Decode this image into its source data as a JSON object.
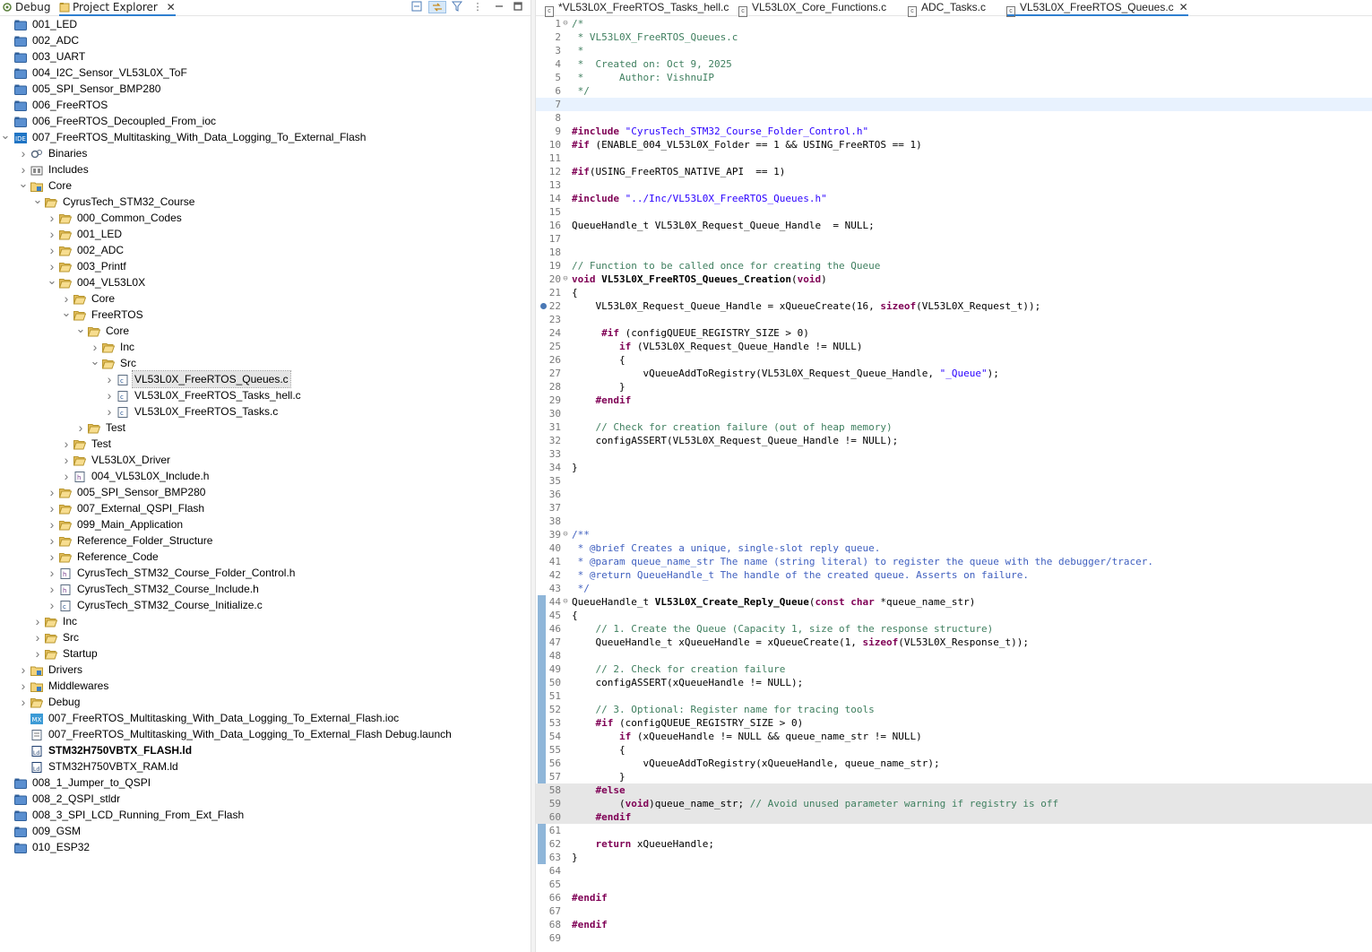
{
  "left_tabs": [
    {
      "label": "Debug"
    },
    {
      "label": "Project Explorer"
    }
  ],
  "tree": [
    {
      "depth": 0,
      "icon": "folder",
      "label": "001_LED",
      "exp": "none"
    },
    {
      "depth": 0,
      "icon": "folder",
      "label": "002_ADC",
      "exp": "none"
    },
    {
      "depth": 0,
      "icon": "folder",
      "label": "003_UART",
      "exp": "none"
    },
    {
      "depth": 0,
      "icon": "folder",
      "label": "004_I2C_Sensor_VL53L0X_ToF",
      "exp": "none"
    },
    {
      "depth": 0,
      "icon": "folder",
      "label": "005_SPI_Sensor_BMP280",
      "exp": "none"
    },
    {
      "depth": 0,
      "icon": "folder",
      "label": "006_FreeRTOS",
      "exp": "none"
    },
    {
      "depth": 0,
      "icon": "folder",
      "label": "006_FreeRTOS_Decoupled_From_ioc",
      "exp": "none"
    },
    {
      "depth": 0,
      "icon": "ide",
      "label": "007_FreeRTOS_Multitasking_With_Data_Logging_To_External_Flash",
      "exp": "open"
    },
    {
      "depth": 1,
      "icon": "binaries",
      "label": "Binaries",
      "exp": "closed"
    },
    {
      "depth": 1,
      "icon": "includes",
      "label": "Includes",
      "exp": "closed"
    },
    {
      "depth": 1,
      "icon": "srcfolder",
      "label": "Core",
      "exp": "open"
    },
    {
      "depth": 2,
      "icon": "openfolder",
      "label": "CyrusTech_STM32_Course",
      "exp": "open"
    },
    {
      "depth": 3,
      "icon": "openfolder",
      "label": "000_Common_Codes",
      "exp": "closed"
    },
    {
      "depth": 3,
      "icon": "openfolder",
      "label": "001_LED",
      "exp": "closed"
    },
    {
      "depth": 3,
      "icon": "openfolder",
      "label": "002_ADC",
      "exp": "closed"
    },
    {
      "depth": 3,
      "icon": "openfolder",
      "label": "003_Printf",
      "exp": "closed"
    },
    {
      "depth": 3,
      "icon": "openfolder",
      "label": "004_VL53L0X",
      "exp": "open"
    },
    {
      "depth": 4,
      "icon": "openfolder",
      "label": "Core",
      "exp": "closed"
    },
    {
      "depth": 4,
      "icon": "openfolder",
      "label": "FreeRTOS",
      "exp": "open"
    },
    {
      "depth": 5,
      "icon": "openfolder",
      "label": "Core",
      "exp": "open"
    },
    {
      "depth": 6,
      "icon": "openfolder",
      "label": "Inc",
      "exp": "closed"
    },
    {
      "depth": 6,
      "icon": "openfolder",
      "label": "Src",
      "exp": "open"
    },
    {
      "depth": 7,
      "icon": "cfile",
      "label": "VL53L0X_FreeRTOS_Queues.c",
      "exp": "closed",
      "selected": true
    },
    {
      "depth": 7,
      "icon": "cfile",
      "label": "VL53L0X_FreeRTOS_Tasks_hell.c",
      "exp": "closed"
    },
    {
      "depth": 7,
      "icon": "cfile",
      "label": "VL53L0X_FreeRTOS_Tasks.c",
      "exp": "closed"
    },
    {
      "depth": 5,
      "icon": "openfolder",
      "label": "Test",
      "exp": "closed"
    },
    {
      "depth": 4,
      "icon": "openfolder",
      "label": "Test",
      "exp": "closed"
    },
    {
      "depth": 4,
      "icon": "openfolder",
      "label": "VL53L0X_Driver",
      "exp": "closed"
    },
    {
      "depth": 4,
      "icon": "hfile",
      "label": "004_VL53L0X_Include.h",
      "exp": "closed"
    },
    {
      "depth": 3,
      "icon": "openfolder",
      "label": "005_SPI_Sensor_BMP280",
      "exp": "closed"
    },
    {
      "depth": 3,
      "icon": "openfolder",
      "label": "007_External_QSPI_Flash",
      "exp": "closed"
    },
    {
      "depth": 3,
      "icon": "openfolder",
      "label": "099_Main_Application",
      "exp": "closed"
    },
    {
      "depth": 3,
      "icon": "openfolder",
      "label": "Reference_Folder_Structure",
      "exp": "closed"
    },
    {
      "depth": 3,
      "icon": "openfolder",
      "label": "Reference_Code",
      "exp": "closed"
    },
    {
      "depth": 3,
      "icon": "hfile",
      "label": "CyrusTech_STM32_Course_Folder_Control.h",
      "exp": "closed"
    },
    {
      "depth": 3,
      "icon": "hfile",
      "label": "CyrusTech_STM32_Course_Include.h",
      "exp": "closed"
    },
    {
      "depth": 3,
      "icon": "cfile",
      "label": "CyrusTech_STM32_Course_Initialize.c",
      "exp": "closed"
    },
    {
      "depth": 2,
      "icon": "openfolder",
      "label": "Inc",
      "exp": "closed"
    },
    {
      "depth": 2,
      "icon": "openfolder",
      "label": "Src",
      "exp": "closed"
    },
    {
      "depth": 2,
      "icon": "openfolder",
      "label": "Startup",
      "exp": "closed"
    },
    {
      "depth": 1,
      "icon": "srcfolder",
      "label": "Drivers",
      "exp": "closed"
    },
    {
      "depth": 1,
      "icon": "srcfolder",
      "label": "Middlewares",
      "exp": "closed"
    },
    {
      "depth": 1,
      "icon": "openfolder",
      "label": "Debug",
      "exp": "closed"
    },
    {
      "depth": 1,
      "icon": "mx",
      "label": "007_FreeRTOS_Multitasking_With_Data_Logging_To_External_Flash.ioc",
      "exp": "none"
    },
    {
      "depth": 1,
      "icon": "launch",
      "label": "007_FreeRTOS_Multitasking_With_Data_Logging_To_External_Flash Debug.launch",
      "exp": "none"
    },
    {
      "depth": 1,
      "icon": "ld",
      "label": "STM32H750VBTX_FLASH.ld",
      "exp": "none",
      "bold": true
    },
    {
      "depth": 1,
      "icon": "ld",
      "label": "STM32H750VBTX_RAM.ld",
      "exp": "none"
    },
    {
      "depth": 0,
      "icon": "folder",
      "label": "008_1_Jumper_to_QSPI",
      "exp": "none"
    },
    {
      "depth": 0,
      "icon": "folder",
      "label": "008_2_QSPI_stldr",
      "exp": "none"
    },
    {
      "depth": 0,
      "icon": "folder",
      "label": "008_3_SPI_LCD_Running_From_Ext_Flash",
      "exp": "none"
    },
    {
      "depth": 0,
      "icon": "folder",
      "label": "009_GSM",
      "exp": "none"
    },
    {
      "depth": 0,
      "icon": "folder",
      "label": "010_ESP32",
      "exp": "none"
    }
  ],
  "editor_tabs": [
    {
      "label": "*VL53L0X_FreeRTOS_Tasks_hell.c",
      "active": false
    },
    {
      "label": "VL53L0X_Core_Functions.c",
      "active": false
    },
    {
      "label": "ADC_Tasks.c",
      "active": false
    },
    {
      "label": "VL53L0X_FreeRTOS_Queues.c",
      "active": true
    }
  ],
  "code": [
    {
      "n": "1",
      "fold": "⊖",
      "s": [
        [
          "/*",
          "cm"
        ]
      ]
    },
    {
      "n": "2",
      "s": [
        [
          " * VL53L0X_FreeRTOS_Queues.c",
          "cm"
        ]
      ]
    },
    {
      "n": "3",
      "s": [
        [
          " *",
          "cm"
        ]
      ]
    },
    {
      "n": "4",
      "s": [
        [
          " *  Created on: Oct 9, 2025",
          "cm"
        ]
      ]
    },
    {
      "n": "5",
      "s": [
        [
          " *      Author: VishnuIP",
          "cm"
        ]
      ]
    },
    {
      "n": "6",
      "s": [
        [
          " */",
          "cm"
        ]
      ]
    },
    {
      "n": "7",
      "cur": true,
      "s": []
    },
    {
      "n": "8",
      "s": []
    },
    {
      "n": "9",
      "s": [
        [
          "#include",
          "kw"
        ],
        [
          " ",
          ""
        ],
        [
          "\"CyrusTech_STM32_Course_Folder_Control.h\"",
          "st"
        ]
      ]
    },
    {
      "n": "10",
      "s": [
        [
          "#if",
          "kw"
        ],
        [
          " (ENABLE_004_VL53L0X_Folder == 1 && USING_FreeRTOS == 1)",
          ""
        ]
      ]
    },
    {
      "n": "11",
      "s": []
    },
    {
      "n": "12",
      "s": [
        [
          "#if",
          "kw"
        ],
        [
          "(USING_FreeRTOS_NATIVE_API  == 1)",
          ""
        ]
      ]
    },
    {
      "n": "13",
      "s": []
    },
    {
      "n": "14",
      "s": [
        [
          "#include",
          "kw"
        ],
        [
          " ",
          ""
        ],
        [
          "\"../Inc/VL53L0X_FreeRTOS_Queues.h\"",
          "st"
        ]
      ]
    },
    {
      "n": "15",
      "s": []
    },
    {
      "n": "16",
      "s": [
        [
          "QueueHandle_t VL53L0X_Request_Queue_Handle  = NULL;",
          ""
        ]
      ]
    },
    {
      "n": "17",
      "s": []
    },
    {
      "n": "18",
      "s": []
    },
    {
      "n": "19",
      "s": [
        [
          "// Function to be called once for creating the Queue",
          "cm"
        ]
      ]
    },
    {
      "n": "20",
      "fold": "⊖",
      "s": [
        [
          "void",
          "kw"
        ],
        [
          " ",
          ""
        ],
        [
          "VL53L0X_FreeRTOS_Queues_Creation",
          "fn"
        ],
        [
          "(",
          ""
        ],
        [
          "void",
          "kw"
        ],
        [
          ")",
          ""
        ]
      ]
    },
    {
      "n": "21",
      "s": [
        [
          "{",
          ""
        ]
      ]
    },
    {
      "n": "22",
      "marker": true,
      "s": [
        [
          "    VL53L0X_Request_Queue_Handle = xQueueCreate(16, ",
          ""
        ],
        [
          "sizeof",
          "kw"
        ],
        [
          "(VL53L0X_Request_t));",
          ""
        ]
      ]
    },
    {
      "n": "23",
      "s": []
    },
    {
      "n": "24",
      "s": [
        [
          "     ",
          ""
        ],
        [
          "#if",
          "kw"
        ],
        [
          " (configQUEUE_REGISTRY_SIZE > 0)",
          ""
        ]
      ]
    },
    {
      "n": "25",
      "s": [
        [
          "        ",
          ""
        ],
        [
          "if",
          "kw"
        ],
        [
          " (VL53L0X_Request_Queue_Handle != NULL)",
          ""
        ]
      ]
    },
    {
      "n": "26",
      "s": [
        [
          "        {",
          ""
        ]
      ]
    },
    {
      "n": "27",
      "s": [
        [
          "            vQueueAddToRegistry(VL53L0X_Request_Queue_Handle, ",
          ""
        ],
        [
          "\"_Queue\"",
          "st"
        ],
        [
          ");",
          ""
        ]
      ]
    },
    {
      "n": "28",
      "s": [
        [
          "        }",
          ""
        ]
      ]
    },
    {
      "n": "29",
      "s": [
        [
          "    ",
          ""
        ],
        [
          "#endif",
          "kw"
        ]
      ]
    },
    {
      "n": "30",
      "s": []
    },
    {
      "n": "31",
      "s": [
        [
          "    // Check for creation failure (out of heap memory)",
          "cm"
        ]
      ]
    },
    {
      "n": "32",
      "s": [
        [
          "    configASSERT(VL53L0X_Request_Queue_Handle != NULL);",
          ""
        ]
      ]
    },
    {
      "n": "33",
      "s": []
    },
    {
      "n": "34",
      "s": [
        [
          "}",
          ""
        ]
      ]
    },
    {
      "n": "35",
      "s": []
    },
    {
      "n": "36",
      "s": []
    },
    {
      "n": "37",
      "s": []
    },
    {
      "n": "38",
      "s": []
    },
    {
      "n": "39",
      "fold": "⊖",
      "s": [
        [
          "/**",
          "dc"
        ]
      ]
    },
    {
      "n": "40",
      "s": [
        [
          " * @brief Creates a unique, single-slot reply queue.",
          "dc"
        ]
      ]
    },
    {
      "n": "41",
      "s": [
        [
          " * @param queue_name_str The name (string literal) to register the queue with the debugger/tracer.",
          "dc"
        ]
      ]
    },
    {
      "n": "42",
      "s": [
        [
          " * @return QueueHandle_t The handle of the created queue. Asserts on failure.",
          "dc"
        ]
      ]
    },
    {
      "n": "43",
      "s": [
        [
          " */",
          "dc"
        ]
      ]
    },
    {
      "n": "44",
      "fold": "⊖",
      "s": [
        [
          "QueueHandle_t ",
          ""
        ],
        [
          "VL53L0X_Create_Reply_Queue",
          "fn"
        ],
        [
          "(",
          ""
        ],
        [
          "const",
          "kw"
        ],
        [
          " ",
          ""
        ],
        [
          "char",
          "kw"
        ],
        [
          " *queue_name_str)",
          ""
        ]
      ]
    },
    {
      "n": "45",
      "s": [
        [
          "{",
          ""
        ]
      ]
    },
    {
      "n": "46",
      "s": [
        [
          "    // 1. Create the Queue (Capacity 1, size of the response structure)",
          "cm"
        ]
      ]
    },
    {
      "n": "47",
      "s": [
        [
          "    QueueHandle_t xQueueHandle = xQueueCreate(1, ",
          ""
        ],
        [
          "sizeof",
          "kw"
        ],
        [
          "(VL53L0X_Response_t));",
          ""
        ]
      ]
    },
    {
      "n": "48",
      "s": []
    },
    {
      "n": "49",
      "s": [
        [
          "    // 2. Check for creation failure",
          "cm"
        ]
      ]
    },
    {
      "n": "50",
      "s": [
        [
          "    configASSERT(xQueueHandle != NULL);",
          ""
        ]
      ]
    },
    {
      "n": "51",
      "s": []
    },
    {
      "n": "52",
      "s": [
        [
          "    // 3. Optional: Register name for tracing tools",
          "cm"
        ]
      ]
    },
    {
      "n": "53",
      "s": [
        [
          "    ",
          ""
        ],
        [
          "#if",
          "kw"
        ],
        [
          " (configQUEUE_REGISTRY_SIZE > 0)",
          ""
        ]
      ]
    },
    {
      "n": "54",
      "s": [
        [
          "        ",
          ""
        ],
        [
          "if",
          "kw"
        ],
        [
          " (xQueueHandle != NULL && queue_name_str != NULL)",
          ""
        ]
      ]
    },
    {
      "n": "55",
      "s": [
        [
          "        {",
          ""
        ]
      ]
    },
    {
      "n": "56",
      "s": [
        [
          "            vQueueAddToRegistry(xQueueHandle, queue_name_str);",
          ""
        ]
      ]
    },
    {
      "n": "57",
      "s": [
        [
          "        }",
          ""
        ]
      ]
    },
    {
      "n": "58",
      "grey": true,
      "s": [
        [
          "    ",
          ""
        ],
        [
          "#else",
          "kw"
        ]
      ]
    },
    {
      "n": "59",
      "grey": true,
      "s": [
        [
          "        (",
          ""
        ],
        [
          "void",
          "kw"
        ],
        [
          ")queue_name_str; ",
          ""
        ],
        [
          "// Avoid unused parameter warning if registry is off",
          "cm"
        ]
      ]
    },
    {
      "n": "60",
      "grey": true,
      "s": [
        [
          "    ",
          ""
        ],
        [
          "#endif",
          "kw"
        ]
      ]
    },
    {
      "n": "61",
      "s": []
    },
    {
      "n": "62",
      "s": [
        [
          "    ",
          ""
        ],
        [
          "return",
          "kw"
        ],
        [
          " xQueueHandle;",
          ""
        ]
      ]
    },
    {
      "n": "63",
      "s": [
        [
          "}",
          ""
        ]
      ]
    },
    {
      "n": "64",
      "s": []
    },
    {
      "n": "65",
      "s": []
    },
    {
      "n": "66",
      "s": [
        [
          "#endif",
          "kw"
        ]
      ]
    },
    {
      "n": "67",
      "s": []
    },
    {
      "n": "68",
      "s": [
        [
          "#endif",
          "kw"
        ]
      ]
    },
    {
      "n": "69",
      "s": []
    }
  ]
}
